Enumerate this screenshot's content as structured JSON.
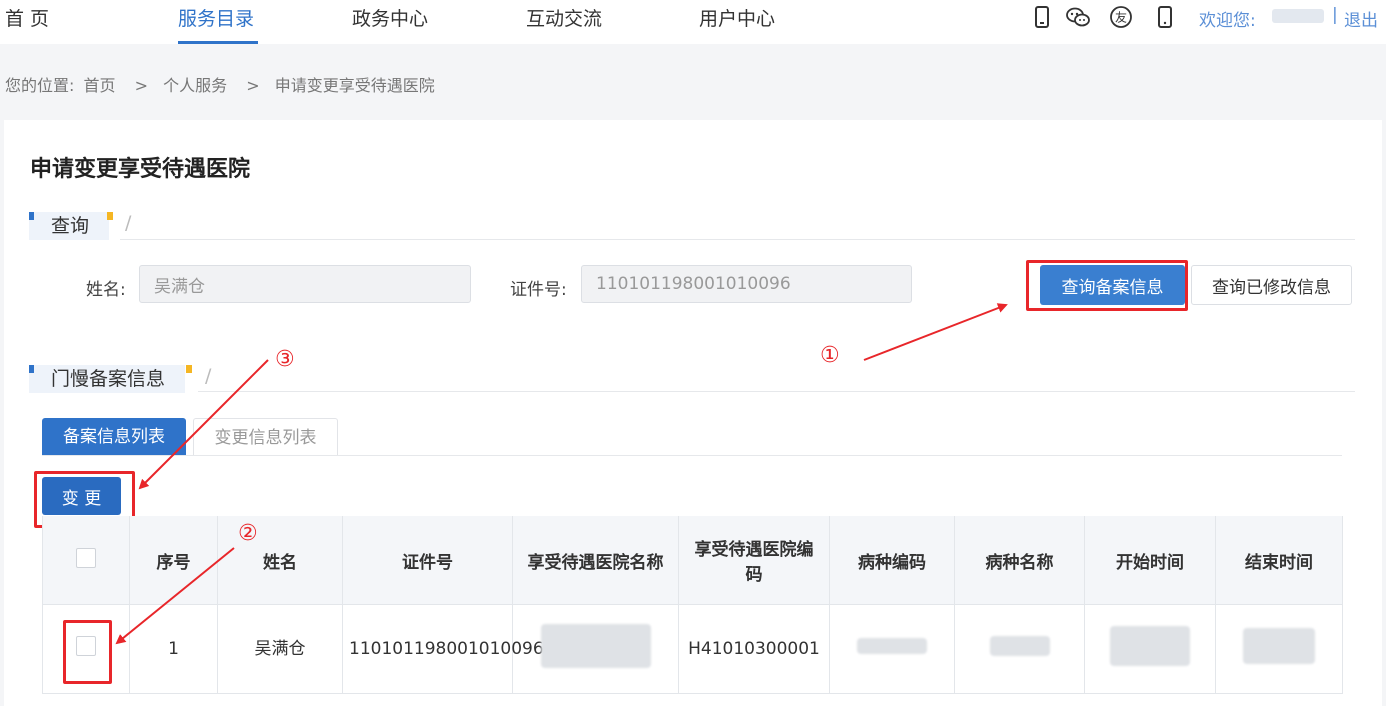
{
  "nav": {
    "items": [
      "首 页",
      "服务目录",
      "政务中心",
      "互动交流",
      "用户中心"
    ],
    "active_index": 1,
    "icons": [
      "mobile-icon",
      "wechat-icon",
      "friend-icon",
      "phone-icon"
    ],
    "welcome": "欢迎您:",
    "separator": "|",
    "logout": "退出"
  },
  "breadcrumb": {
    "label": "您的位置:",
    "items": [
      "首页",
      ">",
      "个人服务",
      ">",
      "申请变更享受待遇医院"
    ]
  },
  "page": {
    "title": "申请变更享受待遇医院"
  },
  "query_section": {
    "title": "查询",
    "slash": "/",
    "name_label": "姓名:",
    "name_value": "吴满仓",
    "id_label": "证件号:",
    "id_value": "110101198001010096",
    "query_button": "查询备案信息",
    "query_modified_button": "查询已修改信息"
  },
  "record_section": {
    "title": "门慢备案信息",
    "slash": "/",
    "tabs": [
      "备案信息列表",
      "变更信息列表"
    ],
    "change_button": "变 更"
  },
  "table": {
    "headers": [
      "序号",
      "姓名",
      "证件号",
      "享受待遇医院名称",
      "享受待遇医院编码",
      "病种编码",
      "病种名称",
      "开始时间",
      "结束时间"
    ],
    "rows": [
      {
        "index": "1",
        "name": "吴满仓",
        "id": "110101198001010096",
        "hospital_code": "H41010300001"
      }
    ]
  },
  "annotations": {
    "step1": "①",
    "step2": "②",
    "step3": "③"
  },
  "colors": {
    "accent": "#2f73c9",
    "annotation": "#e8262a",
    "section_dot": "#f5b623"
  }
}
